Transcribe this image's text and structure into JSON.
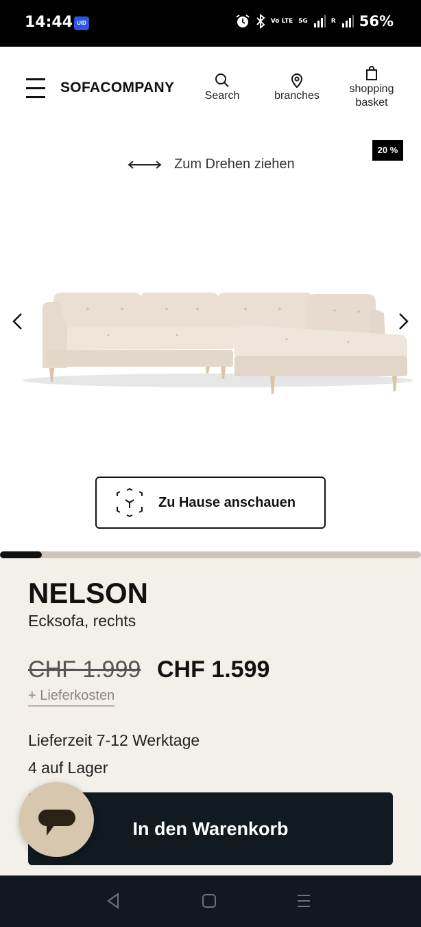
{
  "status_bar": {
    "time": "14:44",
    "uid_badge": "UID",
    "network_volte": "Vo LTE",
    "network_5g": "5G",
    "roaming": "R",
    "battery": "56%"
  },
  "header": {
    "logo": "SOFACOMPANY",
    "search_label": "Search",
    "branches_label": "branches",
    "basket_label_line1": "shopping",
    "basket_label_line2": "basket"
  },
  "gallery": {
    "discount_badge": "20 %",
    "rotate_hint": "Zum Drehen ziehen",
    "ar_button_label": "Zu Hause anschauen",
    "progress": 0.1
  },
  "product": {
    "name": "NELSON",
    "subtitle": "Ecksofa, rechts",
    "old_price": "CHF 1.999",
    "new_price": "CHF 1.599",
    "shipping_link": "+ Lieferkosten",
    "delivery_time": "Lieferzeit 7-12 Werktage",
    "stock": "4 auf Lager",
    "add_to_cart_label": "In den Warenkorb"
  },
  "colors": {
    "panel_bg": "#f3efe9",
    "cart_button_bg": "#101a20",
    "chat_bubble_bg": "#d6c7ae",
    "sofa_fabric": "#ece2d6"
  }
}
